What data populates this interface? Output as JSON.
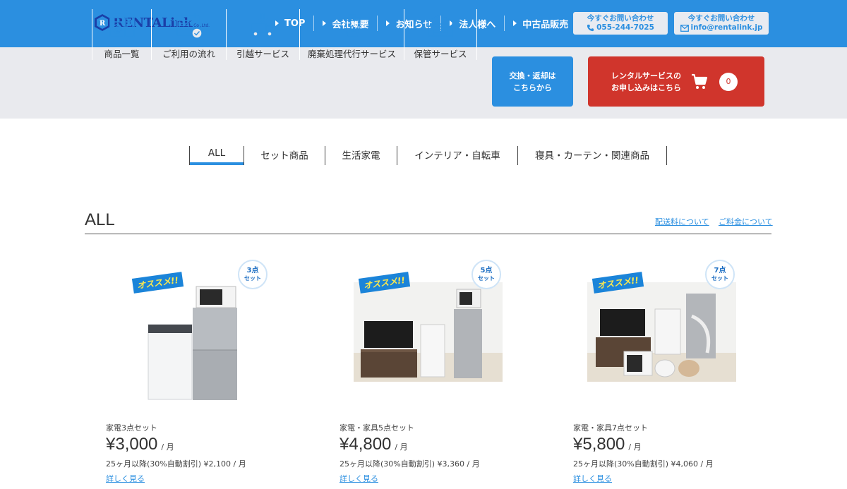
{
  "logo": {
    "text": "RENTALink",
    "sub": "Co.,Ltd.",
    "mark": "R"
  },
  "nav": [
    {
      "label": "TOP"
    },
    {
      "label": "会社概要"
    },
    {
      "label": "お知らせ"
    },
    {
      "label": "法人様へ"
    },
    {
      "label": "中古品販売"
    }
  ],
  "contact_phone": {
    "line1": "今すぐお問い合わせ",
    "line2": "055-244-7025",
    "icon": "phone-icon"
  },
  "contact_mail": {
    "line1": "今すぐお問い合わせ",
    "line2": "info@rentalink.jp",
    "icon": "mail-icon"
  },
  "services": [
    {
      "label": "商品一覧",
      "icon": "appliances-icon"
    },
    {
      "label": "ご利用の流れ",
      "icon": "calendar-icon"
    },
    {
      "label": "引越サービス",
      "icon": "moving-truck-icon"
    },
    {
      "label": "廃棄処理代行サービス",
      "icon": "recycle-bin-icon"
    },
    {
      "label": "保管サービス",
      "icon": "storage-icon"
    }
  ],
  "swap_button": {
    "line1": "交換・返却は",
    "line2": "こちらから"
  },
  "apply_button": {
    "line1": "レンタルサービスの",
    "line2": "お申し込みはこちら",
    "cart_count": "0",
    "icon": "cart-icon"
  },
  "tabs": [
    {
      "label": "ALL",
      "active": true
    },
    {
      "label": "セット商品"
    },
    {
      "label": "生活家電"
    },
    {
      "label": "インテリア・自転車"
    },
    {
      "label": "寝具・カーテン・関連商品"
    }
  ],
  "section": {
    "title": "ALL",
    "link_shipping": "配送料について",
    "link_fee": "ご料金について"
  },
  "products": [
    {
      "recommend": "オススメ!!",
      "badge_count": "3点",
      "badge_unit": "セット",
      "name": "家電3点セット",
      "price": "¥3,000",
      "unit": "/ 月",
      "discount": "25ヶ月以降(30%自動割引) ¥2,100 / 月",
      "more": "詳しく見る"
    },
    {
      "recommend": "オススメ!!",
      "badge_count": "5点",
      "badge_unit": "セット",
      "name": "家電・家具5点セット",
      "price": "¥4,800",
      "unit": "/ 月",
      "discount": "25ヶ月以降(30%自動割引) ¥3,360 / 月",
      "more": "詳しく見る"
    },
    {
      "recommend": "オススメ!!",
      "badge_count": "7点",
      "badge_unit": "セット",
      "name": "家電・家具7点セット",
      "price": "¥5,800",
      "unit": "/ 月",
      "discount": "25ヶ月以降(30%自動割引) ¥4,060 / 月",
      "more": "詳しく見る"
    }
  ],
  "colors": {
    "primary": "#2b8fe0",
    "accent": "#d0352c",
    "service_bg": "#e9eaee"
  }
}
